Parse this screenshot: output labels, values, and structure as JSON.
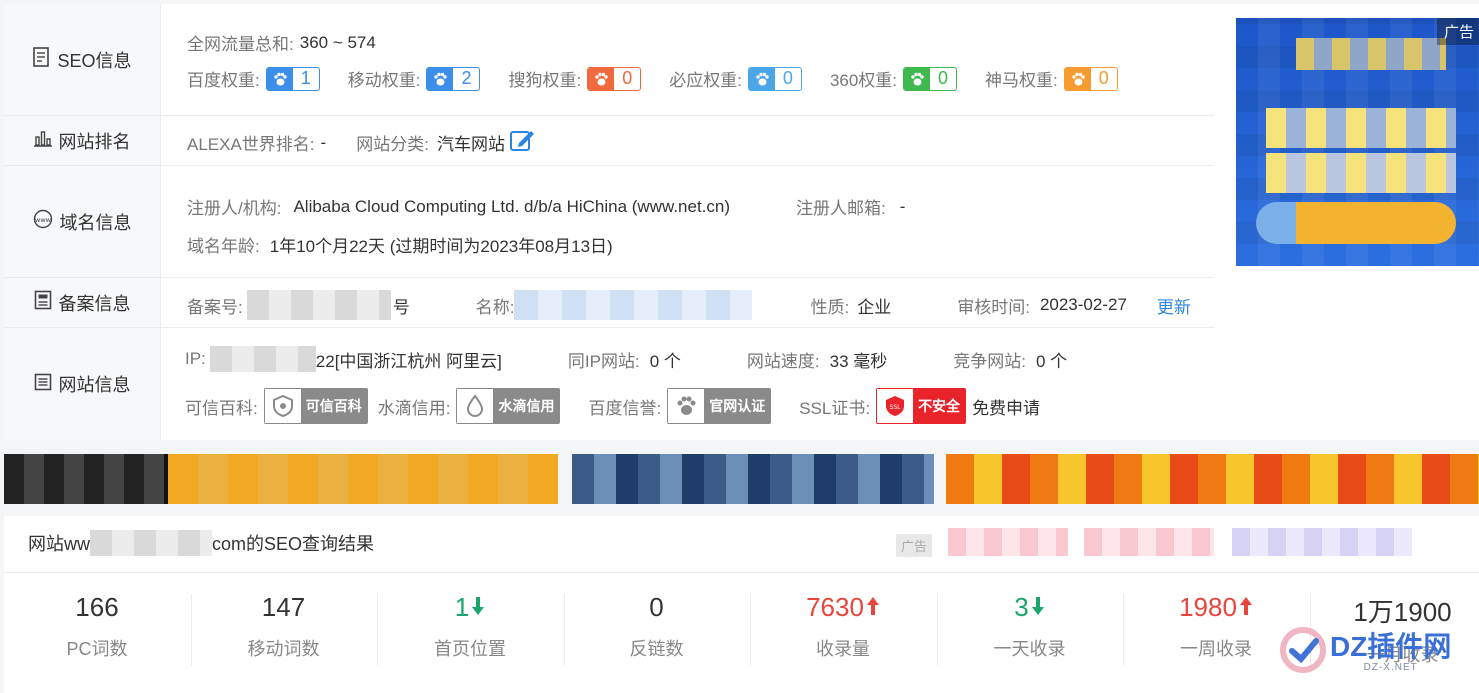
{
  "seo": {
    "title": "SEO信息",
    "traffic_label": "全网流量总和:",
    "traffic_value": "360 ~ 574",
    "weights": [
      {
        "label": "百度权重:",
        "value": "1",
        "color": "#3c8ee8",
        "icon": "paw-icon"
      },
      {
        "label": "移动权重:",
        "value": "2",
        "color": "#3c8ee8",
        "icon": "paw-icon"
      },
      {
        "label": "搜狗权重:",
        "value": "0",
        "color": "#f06a3d",
        "icon": "sogou-icon"
      },
      {
        "label": "必应权重:",
        "value": "0",
        "color": "#4ba6e8",
        "icon": "bing-icon"
      },
      {
        "label": "360权重:",
        "value": "0",
        "color": "#3fb94f",
        "icon": "360-icon"
      },
      {
        "label": "神马权重:",
        "value": "0",
        "color": "#f59b2f",
        "icon": "shenma-icon"
      }
    ]
  },
  "rank": {
    "title": "网站排名",
    "alexa_label": "ALEXA世界排名:",
    "alexa_value": "-",
    "category_label": "网站分类:",
    "category_value": "汽车网站"
  },
  "domain": {
    "title": "域名信息",
    "registrant_label": "注册人/机构:",
    "registrant_value": "Alibaba Cloud Computing Ltd. d/b/a HiChina (www.net.cn)",
    "email_label": "注册人邮箱:",
    "email_value": "-",
    "age_label": "域名年龄:",
    "age_value": "1年10个月22天 (过期时间为2023年08月13日)"
  },
  "icp": {
    "title": "备案信息",
    "number_label": "备案号:",
    "number_suffix": "号",
    "name_label": "名称:",
    "type_label": "性质:",
    "type_value": "企业",
    "audit_label": "审核时间:",
    "audit_value": "2023-02-27",
    "update_link": "更新"
  },
  "site": {
    "title": "网站信息",
    "ip_label": "IP:",
    "ip_suffix": "22[中国浙江杭州 阿里云]",
    "sameip_label": "同IP网站:",
    "sameip_value": "0 个",
    "speed_label": "网站速度:",
    "speed_value": "33 毫秒",
    "compete_label": "竞争网站:",
    "compete_value": "0 个",
    "kexin_label": "可信百科:",
    "kexin_badge": "可信百科",
    "shuidi_label": "水滴信用:",
    "shuidi_badge": "水滴信用",
    "baidu_label": "百度信誉:",
    "baidu_badge": "官网认证",
    "ssl_label": "SSL证书:",
    "ssl_badge": "不安全",
    "ssl_icon_text": "SSL",
    "ssl_apply": "免费申请"
  },
  "side_ad": {
    "tag": "广告"
  },
  "results": {
    "title_prefix": "网站ww",
    "title_suffix": "com的SEO查询结果",
    "ad_tag": "广告",
    "stats": [
      {
        "value": "166",
        "label": "PC词数",
        "trend": ""
      },
      {
        "value": "147",
        "label": "移动词数",
        "trend": ""
      },
      {
        "value": "1",
        "label": "首页位置",
        "trend": "down"
      },
      {
        "value": "0",
        "label": "反链数",
        "trend": ""
      },
      {
        "value": "7630",
        "label": "收录量",
        "trend": "up"
      },
      {
        "value": "3",
        "label": "一天收录",
        "trend": "down"
      },
      {
        "value": "1980",
        "label": "一周收录",
        "trend": "up"
      },
      {
        "value": "1万1900",
        "label": "一月收录",
        "trend": ""
      }
    ]
  },
  "watermark": {
    "brand": "DZ插件网",
    "sub": "DZ-X.NET"
  }
}
